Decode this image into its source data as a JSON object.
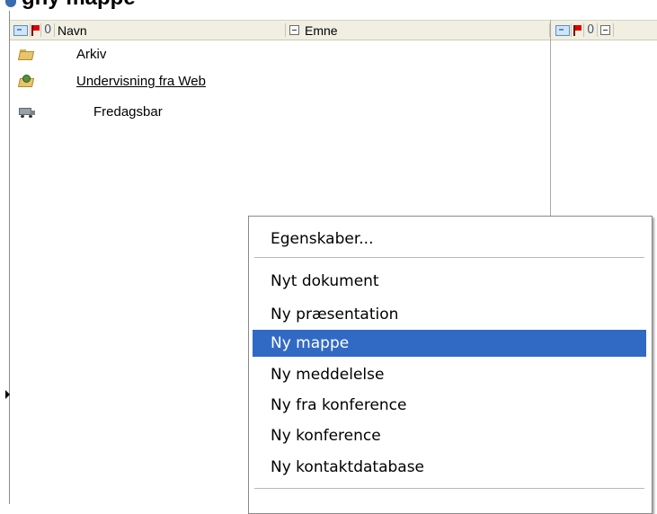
{
  "title_fragment": "gny mappe",
  "columns": {
    "name": "Navn",
    "subject": "Emne"
  },
  "rows": [
    {
      "label": "Arkiv",
      "icon": "folder-icon",
      "underline": false
    },
    {
      "label": "Undervisning fra Web",
      "icon": "web-folder-icon",
      "underline": true
    },
    {
      "label": "Fredagsbar",
      "icon": "truck-icon",
      "underline": false
    }
  ],
  "context_menu": {
    "items": [
      {
        "label": "Egenskaber...",
        "selected": false
      },
      {
        "label": "Nyt dokument",
        "selected": false
      },
      {
        "label": "Ny præsentation",
        "selected": false
      },
      {
        "label": "Ny mappe",
        "selected": true
      },
      {
        "label": "Ny meddelelse",
        "selected": false
      },
      {
        "label": "Ny fra konference",
        "selected": false
      },
      {
        "label": "Ny konference",
        "selected": false
      },
      {
        "label": "Ny kontaktdatabase",
        "selected": false
      }
    ]
  },
  "colors": {
    "selection": "#316ac5",
    "header_bg": "#f1efe2"
  }
}
